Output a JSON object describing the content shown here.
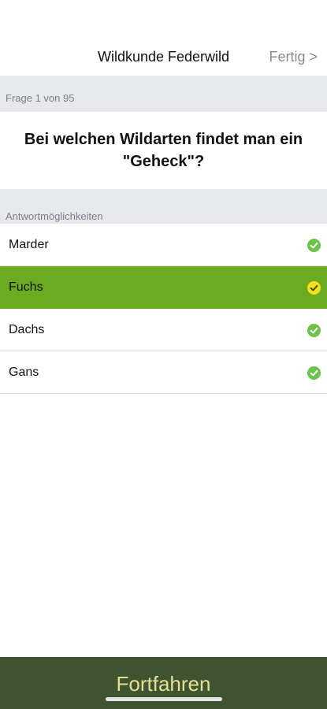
{
  "nav": {
    "title": "Wildkunde Federwild",
    "done_label": "Fertig >"
  },
  "counter": {
    "text": "Frage 1 von 95"
  },
  "question": {
    "text": "Bei welchen Wildarten findet man ein \"Geheck\"?"
  },
  "answers_header": "Antwortmöglichkeiten",
  "answers": [
    {
      "label": "Marder",
      "selected": false
    },
    {
      "label": "Fuchs",
      "selected": true
    },
    {
      "label": "Dachs",
      "selected": false
    },
    {
      "label": "Gans",
      "selected": false
    }
  ],
  "footer": {
    "button_label": "Fortfahren"
  },
  "colors": {
    "selected_row": "#6aab1f",
    "check_icon": "#6cc24a",
    "selected_check_icon": "#f3e21a",
    "footer_bg": "#3f5430",
    "footer_text": "#e9df93"
  }
}
